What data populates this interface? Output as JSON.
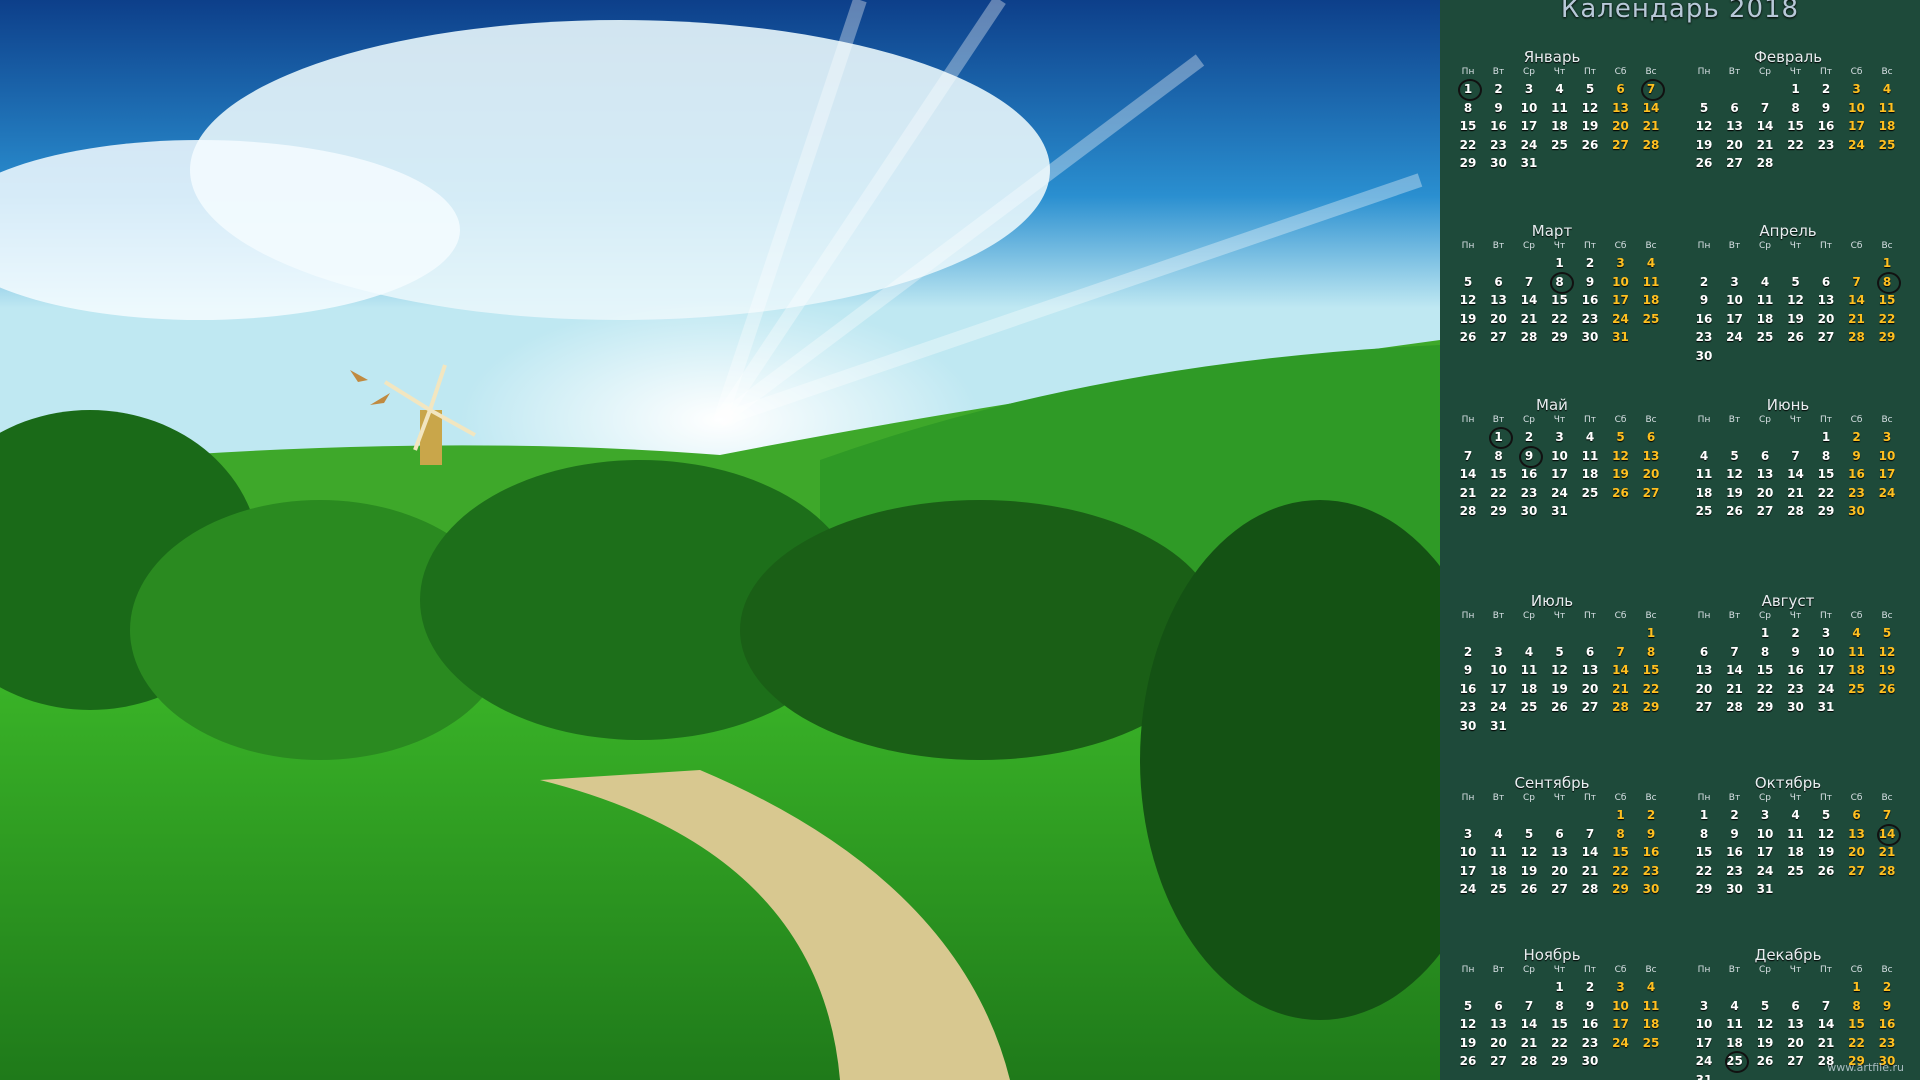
{
  "title": "Календарь 2018",
  "watermark": "www.artfile.ru",
  "colors": {
    "panel": "#1e4a3a",
    "weekday": "#ffffff",
    "weekend": "#ffc020",
    "sky": "#1f7fc0",
    "grass": "#2e9e2a"
  },
  "weekdays": [
    "Пн",
    "Вт",
    "Ср",
    "Чт",
    "Пт",
    "Сб",
    "Вс"
  ],
  "months": [
    {
      "name": "Январь",
      "days": 31,
      "start": 0,
      "highlights": [
        1,
        7
      ]
    },
    {
      "name": "Февраль",
      "days": 28,
      "start": 3,
      "highlights": []
    },
    {
      "name": "Март",
      "days": 31,
      "start": 3,
      "highlights": [
        8
      ]
    },
    {
      "name": "Апрель",
      "days": 30,
      "start": 6,
      "highlights": [
        8
      ]
    },
    {
      "name": "Май",
      "days": 31,
      "start": 1,
      "highlights": [
        1,
        9
      ]
    },
    {
      "name": "Июнь",
      "days": 30,
      "start": 4,
      "highlights": []
    },
    {
      "name": "Июль",
      "days": 31,
      "start": 6,
      "highlights": []
    },
    {
      "name": "Август",
      "days": 31,
      "start": 2,
      "highlights": []
    },
    {
      "name": "Сентябрь",
      "days": 30,
      "start": 5,
      "highlights": []
    },
    {
      "name": "Октябрь",
      "days": 31,
      "start": 0,
      "highlights": [
        14
      ]
    },
    {
      "name": "Ноябрь",
      "days": 30,
      "start": 3,
      "highlights": []
    },
    {
      "name": "Декабрь",
      "days": 31,
      "start": 5,
      "highlights": [
        25
      ]
    }
  ]
}
